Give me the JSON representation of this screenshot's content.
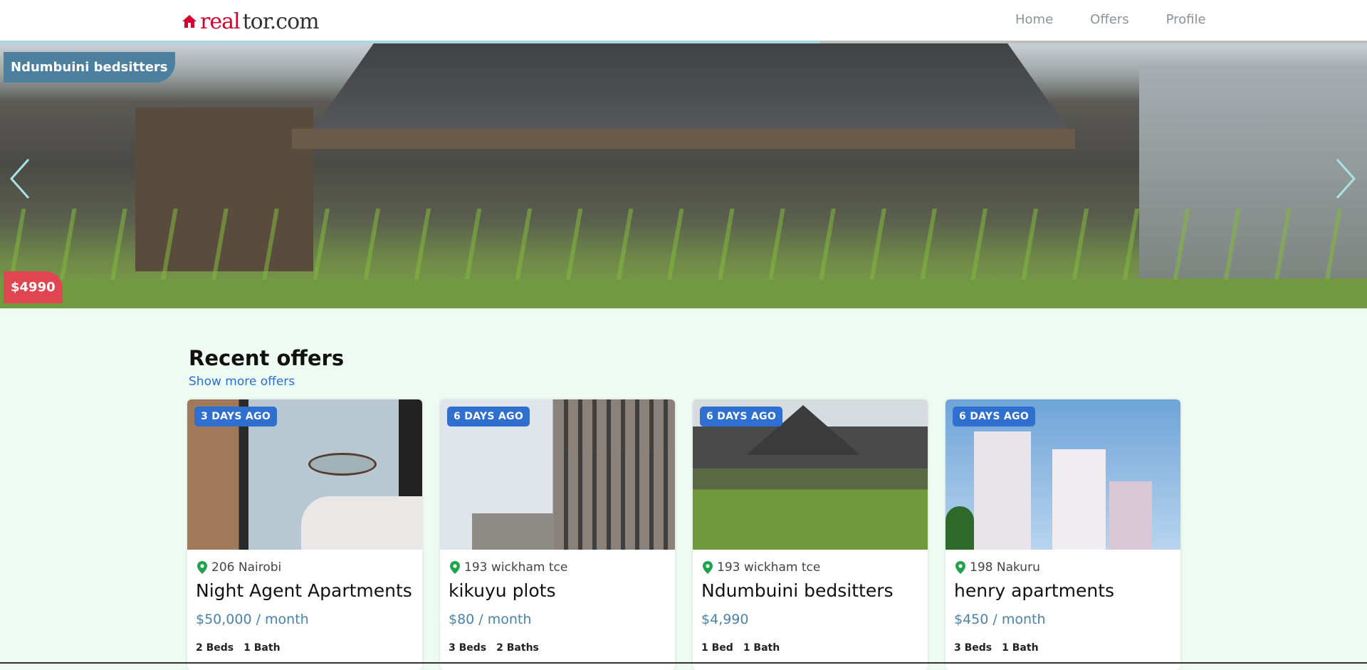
{
  "nav": {
    "logo_left": "real",
    "logo_right": "tor.com",
    "links": [
      "Home",
      "Offers",
      "Profile"
    ],
    "progress": 0.6
  },
  "hero": {
    "title": "Ndumbuini bedsitters",
    "price": "$4990"
  },
  "section": {
    "title": "Recent offers",
    "more_link": "Show more offers"
  },
  "cards": [
    {
      "badge": "3 DAYS AGO",
      "location": "206 Nairobi",
      "name": "Night Agent Apartments",
      "price": "$50,000 / month",
      "beds": "2 Beds",
      "baths": "1 Bath"
    },
    {
      "badge": "6 DAYS AGO",
      "location": "193 wickham tce",
      "name": "kikuyu plots",
      "price": "$80 / month",
      "beds": "3 Beds",
      "baths": "2 Baths"
    },
    {
      "badge": "6 DAYS AGO",
      "location": "193 wickham tce",
      "name": "Ndumbuini bedsitters",
      "price": "$4,990",
      "beds": "1 Bed",
      "baths": "1 Bath"
    },
    {
      "badge": "6 DAYS AGO",
      "location": "198 Nakuru",
      "name": "henry apartments",
      "price": "$450 / month",
      "beds": "3 Beds",
      "baths": "1 Bath"
    }
  ],
  "colors": {
    "accent": "#2f6fcf",
    "price_text": "#4b82a8",
    "price_badge": "#e04552",
    "title_badge": "#4d7f9f",
    "pin": "#1fa34a",
    "page_bg": "#eefbf2"
  }
}
